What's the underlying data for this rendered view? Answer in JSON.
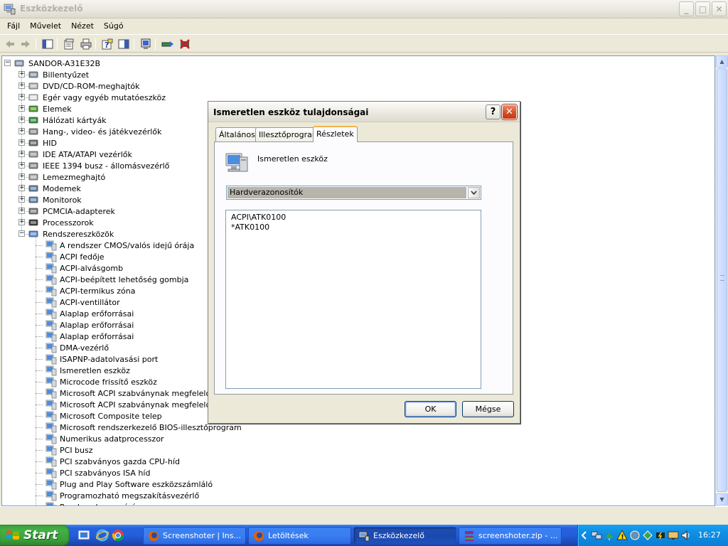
{
  "window": {
    "title": "Eszközkezelő",
    "controls": {
      "minimize": "_",
      "maximize": "□",
      "close": "✕"
    }
  },
  "menubar": [
    "Fájl",
    "Művelet",
    "Nézet",
    "Súgó"
  ],
  "toolbar": {
    "icons": [
      "back-icon",
      "forward-icon",
      "console-tree-icon",
      "properties-icon",
      "print-icon",
      "help-icon",
      "show-hide-icon",
      "scan-hardware-icon",
      "update-driver-icon",
      "uninstall-icon"
    ]
  },
  "tree": {
    "root": "SANDOR-A31E32B",
    "categories": [
      "Billentyűzet",
      "DVD/CD-ROM-meghajtók",
      "Egér vagy egyéb mutatóeszköz",
      "Elemek",
      "Hálózati kártyák",
      "Hang-, video- és játékvezérlők",
      "HID",
      "IDE ATA/ATAPI vezérlők",
      "IEEE 1394 busz - állomásvezérlő",
      "Lemezmeghajtó",
      "Modemek",
      "Monitorok",
      "PCMCIA-adapterek",
      "Processzorok",
      "Rendszereszközök"
    ],
    "system_devices": [
      "A rendszer CMOS/valós idejű órája",
      "ACPI fedője",
      "ACPI-alvásgomb",
      "ACPI-beépített lehetőség gombja",
      "ACPI-termikus zóna",
      "ACPI-ventillátor",
      "Alaplap erőforrásai",
      "Alaplap erőforrásai",
      "Alaplap erőforrásai",
      "DMA-vezérlő",
      "ISAPNP-adatolvasási port",
      "Ismeretlen eszköz",
      "Microcode frissítő eszköz",
      "Microsoft ACPI szabványnak megfelelő beág",
      "Microsoft ACPI szabványnak megfelelő rends",
      "Microsoft Composite telep",
      "Microsoft rendszerkezelő BIOS-illesztőprogram",
      "Numerikus adatprocesszor",
      "PCI busz",
      "PCI szabványos gazda CPU-híd",
      "PCI szabványos ISA híd",
      "Plug and Play Software eszközszámláló",
      "Programozható megszakításvezérlő",
      "Rendszerhangszóró"
    ]
  },
  "dialog": {
    "title": "Ismeretlen eszköz tulajdonságai",
    "help_button": "?",
    "close_button": "✕",
    "tabs": [
      "Általános",
      "Illesztőprogram",
      "Részletek"
    ],
    "active_tab": "Részletek",
    "device_name": "Ismeretlen eszköz",
    "property_select": "Hardverazonosítók",
    "values": [
      "ACPI\\ATK0100",
      "*ATK0100"
    ],
    "ok_label": "OK",
    "cancel_label": "Mégse"
  },
  "taskbar": {
    "start_label": "Start",
    "items": [
      {
        "label": "Screenshoter | Ins...",
        "icon": "firefox-icon"
      },
      {
        "label": "Letöltések",
        "icon": "firefox-icon"
      },
      {
        "label": "Eszközkezelő",
        "icon": "device-manager-icon"
      },
      {
        "label": "screenshoter.zip - ...",
        "icon": "winrar-icon"
      }
    ],
    "clock": "16:27"
  },
  "colors": {
    "taskbar_blue": "#245edb",
    "start_green": "#3aa13b",
    "tray_blue": "#0f8fe3",
    "active_tab_accent": "#f1b44b"
  }
}
